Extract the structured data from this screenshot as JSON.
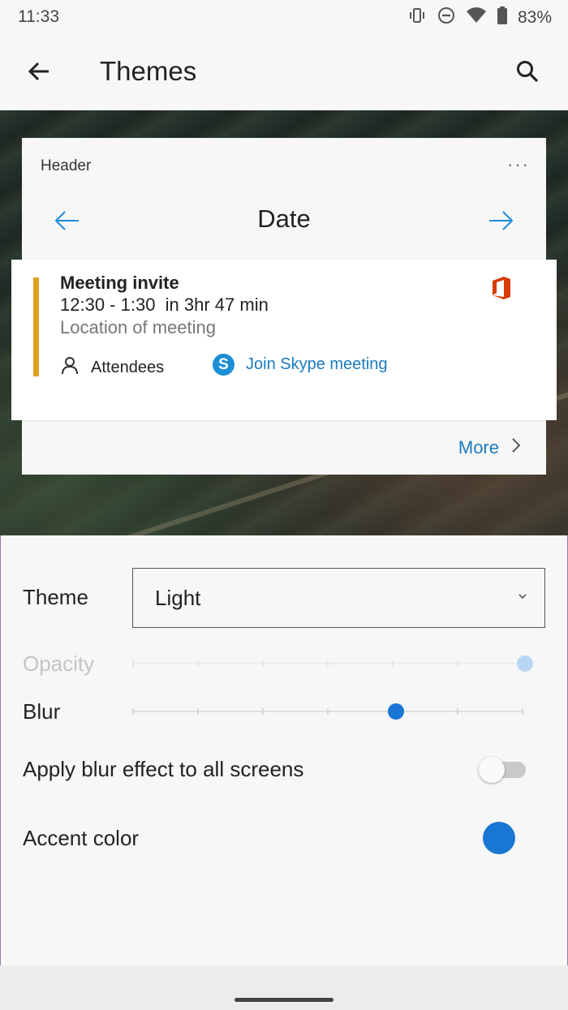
{
  "status_bar": {
    "time": "11:33",
    "battery": "83%",
    "icons": [
      "vibrate-icon",
      "do-not-disturb-icon",
      "wifi-icon",
      "battery-icon"
    ]
  },
  "app_bar": {
    "title": "Themes",
    "back_icon": "arrow-left-icon",
    "search_icon": "search-icon"
  },
  "preview": {
    "widget": {
      "header": "Header",
      "menu_icon": "more-horizontal-icon",
      "date_label": "Date",
      "prev_icon": "arrow-left-icon",
      "next_icon": "arrow-right-icon",
      "event": {
        "title": "Meeting invite",
        "time": "12:30 - 1:30  in 3hr 47 min",
        "location": "Location of meeting",
        "attendees_label": "Attendees",
        "skype_label": "Join Skype meeting",
        "accent_bar_color": "#e0a020",
        "app_icon": "office-icon"
      },
      "more_label": "More"
    }
  },
  "settings": {
    "theme": {
      "label": "Theme",
      "selected": "Light"
    },
    "opacity": {
      "label": "Opacity",
      "value_fraction": 1.0,
      "enabled": false
    },
    "blur": {
      "label": "Blur",
      "value_fraction": 0.67,
      "ticks": 7
    },
    "apply_blur": {
      "label": "Apply blur effect to all screens",
      "enabled": false
    },
    "accent": {
      "label": "Accent color",
      "color": "#1976d2"
    }
  },
  "colors": {
    "link": "#1a7bbf",
    "accent": "#1976d2",
    "opacity_thumb_disabled": "#b8d6f3"
  }
}
